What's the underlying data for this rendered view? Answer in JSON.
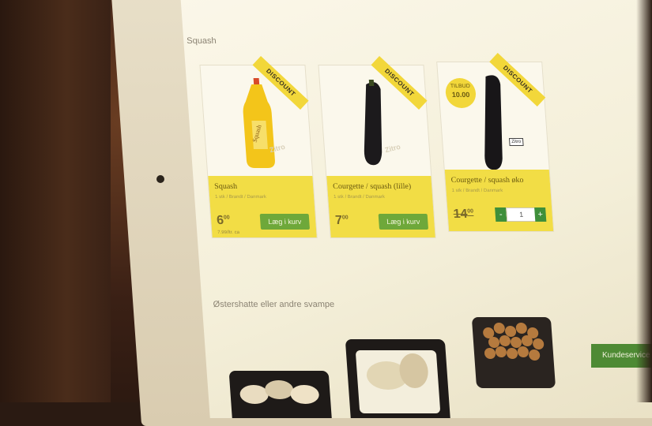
{
  "section_squash": "Squash",
  "section_mushrooms": "Østershatte eller andre svampe",
  "products": [
    {
      "name": "Squash",
      "desc": "1 stk / Brandt / Danmark",
      "price_main": "6",
      "price_cents": "00",
      "subprice": "7.99/ltr. ca",
      "ribbon": "DISCOUNT",
      "button": "Læg i kurv"
    },
    {
      "name": "Courgette / squash (lille)",
      "desc": "1 stk / Brandt / Danmark",
      "price_main": "7",
      "price_cents": "00",
      "ribbon": "DISCOUNT",
      "button": "Læg i kurv"
    },
    {
      "name": "Courgette / squash øko",
      "desc": "1 stk / Brandt / Danmark",
      "price_main": "14",
      "price_cents": "00",
      "ribbon": "DISCOUNT",
      "badge_line1": "TILBUD",
      "badge_line2": "10.00",
      "quantity": "1",
      "minus": "-",
      "plus": "+"
    }
  ],
  "kundeservice": "Kundeservice",
  "icons": [
    "bottle-icon",
    "courgette-icon"
  ]
}
